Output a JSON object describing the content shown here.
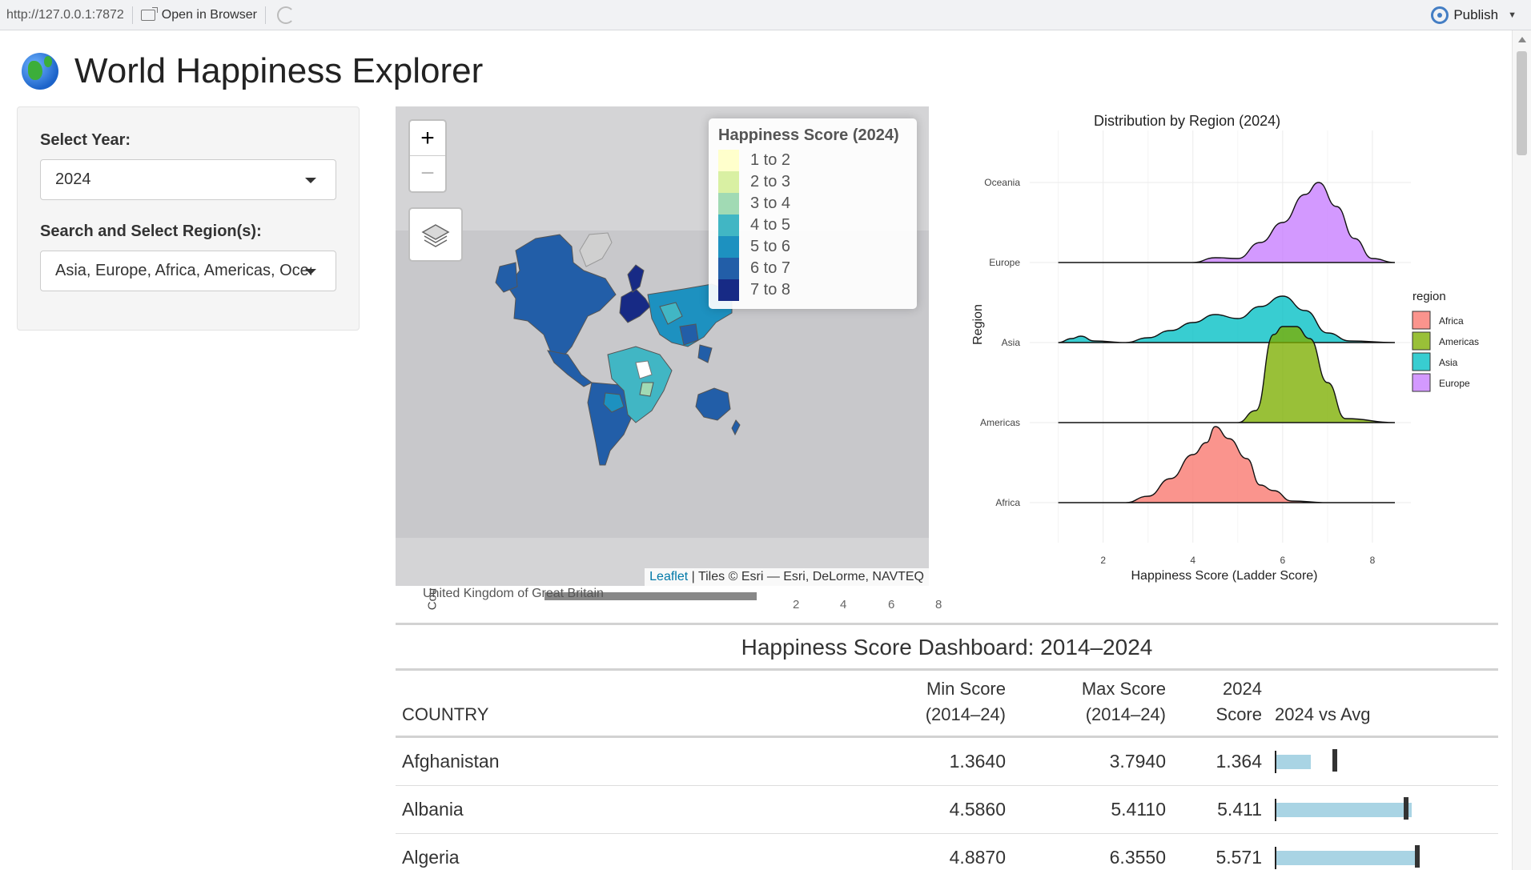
{
  "viewer": {
    "url": "http://127.0.0.1:7872",
    "open_label": "Open in Browser",
    "publish_label": "Publish"
  },
  "header": {
    "title": "World Happiness Explorer"
  },
  "sidebar": {
    "year_label": "Select Year:",
    "year_value": "2024",
    "region_label": "Search and Select Region(s):",
    "region_value": "Asia, Europe, Africa, Americas, Oceania"
  },
  "map": {
    "zoom_in": "+",
    "zoom_out": "−",
    "legend_title": "Happiness Score (2024)",
    "legend": [
      {
        "label": "1 to 2",
        "color": "#ffffcc"
      },
      {
        "label": "2 to 3",
        "color": "#d9f0a3"
      },
      {
        "label": "3 to 4",
        "color": "#a1dab4"
      },
      {
        "label": "4 to 5",
        "color": "#41b6c4"
      },
      {
        "label": "5 to 6",
        "color": "#1d91c0"
      },
      {
        "label": "6 to 7",
        "color": "#225ea8"
      },
      {
        "label": "7 to 8",
        "color": "#172a85"
      }
    ],
    "attribution_link": "Leaflet",
    "attribution_text": " | Tiles © Esri — Esri, DeLorme, NAVTEQ"
  },
  "overflow": {
    "y_label": "Cou",
    "label": "United Kingdom of Great Britain",
    "ticks": [
      "2",
      "4",
      "6",
      "8"
    ]
  },
  "chart_data": {
    "type": "ridgeline",
    "title": "Distribution by Region (2024)",
    "xlabel": "Happiness Score (Ladder Score)",
    "ylabel": "Region",
    "xlim": [
      0.9,
      8.5
    ],
    "xticks": [
      2,
      4,
      6,
      8
    ],
    "categories": [
      "Africa",
      "Americas",
      "Asia",
      "Europe",
      "Oceania"
    ],
    "legend_title": "region",
    "legend": [
      {
        "name": "Africa",
        "color": "#f8766d"
      },
      {
        "name": "Americas",
        "color": "#7cae00"
      },
      {
        "name": "Asia",
        "color": "#00bfc4"
      },
      {
        "name": "Europe",
        "color": "#c77cff"
      }
    ],
    "series": [
      {
        "name": "Africa",
        "color": "#f8766d",
        "x": [
          1.0,
          2.5,
          3.0,
          3.5,
          4.0,
          4.3,
          4.5,
          4.8,
          5.2,
          5.5,
          5.8,
          6.2,
          7.0,
          8.5
        ],
        "density": [
          0,
          0,
          0.08,
          0.3,
          0.6,
          0.75,
          0.95,
          0.8,
          0.55,
          0.22,
          0.15,
          0.02,
          0,
          0
        ]
      },
      {
        "name": "Americas",
        "color": "#7cae00",
        "x": [
          1.0,
          5.0,
          5.4,
          5.8,
          6.0,
          6.3,
          6.6,
          7.0,
          7.4,
          8.5
        ],
        "density": [
          0,
          0,
          0.15,
          1.1,
          1.2,
          1.2,
          1.05,
          0.5,
          0.05,
          0
        ]
      },
      {
        "name": "Asia",
        "color": "#00bfc4",
        "x": [
          1.0,
          1.3,
          1.5,
          1.8,
          2.5,
          3.0,
          3.5,
          4.0,
          4.5,
          5.0,
          5.5,
          6.0,
          6.5,
          7.0,
          7.5,
          8.5
        ],
        "density": [
          0,
          0.05,
          0.08,
          0.02,
          0,
          0.06,
          0.15,
          0.25,
          0.35,
          0.3,
          0.45,
          0.58,
          0.4,
          0.12,
          0.02,
          0
        ]
      },
      {
        "name": "Europe",
        "color": "#c77cff",
        "x": [
          1.0,
          4.0,
          4.5,
          5.0,
          5.5,
          6.0,
          6.5,
          6.8,
          7.2,
          7.6,
          8.0,
          8.5
        ],
        "density": [
          0,
          0,
          0.06,
          0.05,
          0.25,
          0.5,
          0.85,
          1.0,
          0.7,
          0.3,
          0.05,
          0
        ]
      }
    ]
  },
  "table": {
    "title": "Happiness Score Dashboard: 2014–2024",
    "headers": {
      "country": "COUNTRY",
      "min_1": "Min Score",
      "min_2": "(2014–24)",
      "max_1": "Max Score",
      "max_2": "(2014–24)",
      "score_1": "2024",
      "score_2": "Score",
      "vs": "2024 vs Avg"
    },
    "bullet_max": 8,
    "rows": [
      {
        "country": "Afghanistan",
        "min": "1.3640",
        "max": "3.7940",
        "score": "1.364",
        "score_value": 1.364,
        "avg_value": 2.1
      },
      {
        "country": "Albania",
        "min": "4.5860",
        "max": "5.4110",
        "score": "5.411",
        "score_value": 5.411,
        "avg_value": 4.95
      },
      {
        "country": "Algeria",
        "min": "4.8870",
        "max": "6.3550",
        "score": "5.571",
        "score_value": 5.571,
        "avg_value": 5.4
      }
    ]
  }
}
